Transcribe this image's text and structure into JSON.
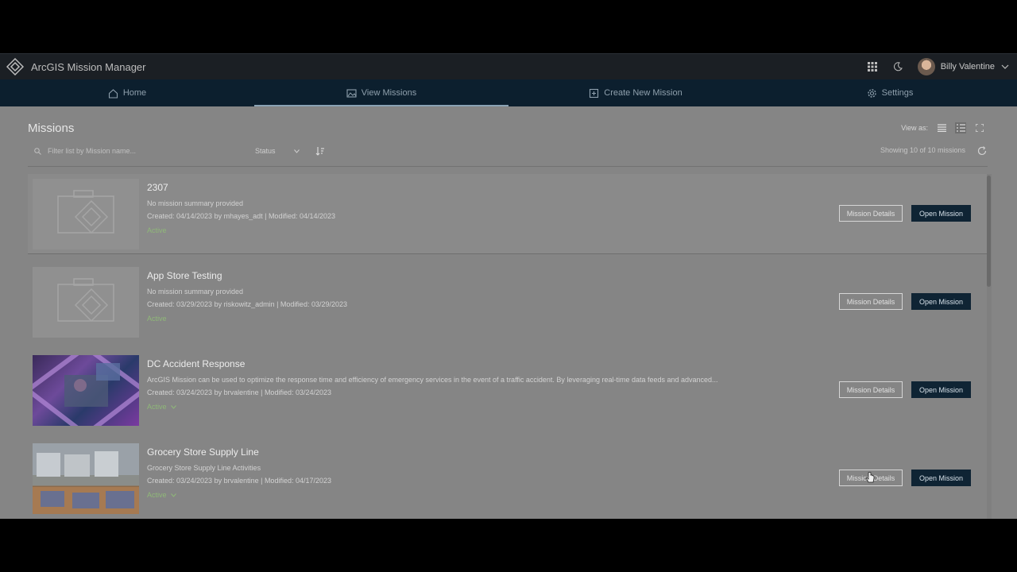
{
  "app": {
    "title": "ArcGIS Mission Manager"
  },
  "user": {
    "name": "Billy Valentine"
  },
  "nav": [
    {
      "label": "Home",
      "icon": "home-icon"
    },
    {
      "label": "View Missions",
      "icon": "image-icon",
      "active": true
    },
    {
      "label": "Create New Mission",
      "icon": "plus-square-icon"
    },
    {
      "label": "Settings",
      "icon": "gear-icon"
    }
  ],
  "page": {
    "title": "Missions",
    "view_as_label": "View as:",
    "search_placeholder": "Filter list by Mission name...",
    "status_label": "Status",
    "showing": "Showing 10 of 10 missions"
  },
  "missions": [
    {
      "title": "2307",
      "summary": "No mission summary provided",
      "meta": "Created: 04/14/2023 by mhayes_adt | Modified: 04/14/2023",
      "status": "Active",
      "details_label": "Mission Details",
      "open_label": "Open Mission"
    },
    {
      "title": "App Store Testing",
      "summary": "No mission summary provided",
      "meta": "Created: 03/29/2023 by riskowitz_admin | Modified: 03/29/2023",
      "status": "Active",
      "details_label": "Mission Details",
      "open_label": "Open Mission"
    },
    {
      "title": "DC Accident Response",
      "summary": "ArcGIS Mission can be used to optimize the response time and efficiency of emergency services in the event of a traffic accident. By leveraging real-time data feeds and advanced...",
      "meta": "Created: 03/24/2023 by brvalentine | Modified: 03/24/2023",
      "status": "Active",
      "details_label": "Mission Details",
      "open_label": "Open Mission"
    },
    {
      "title": "Grocery Store Supply Line",
      "summary": "Grocery Store Supply Line Activities",
      "meta": "Created: 03/24/2023 by brvalentine | Modified: 04/17/2023",
      "status": "Active",
      "details_label": "Mission Details",
      "open_label": "Open Mission"
    }
  ],
  "colors": {
    "nav_bg": "#0c1f2e",
    "topbar_bg": "#1b1f24",
    "status_active": "#8fb878",
    "open_button": "#0f2434"
  }
}
